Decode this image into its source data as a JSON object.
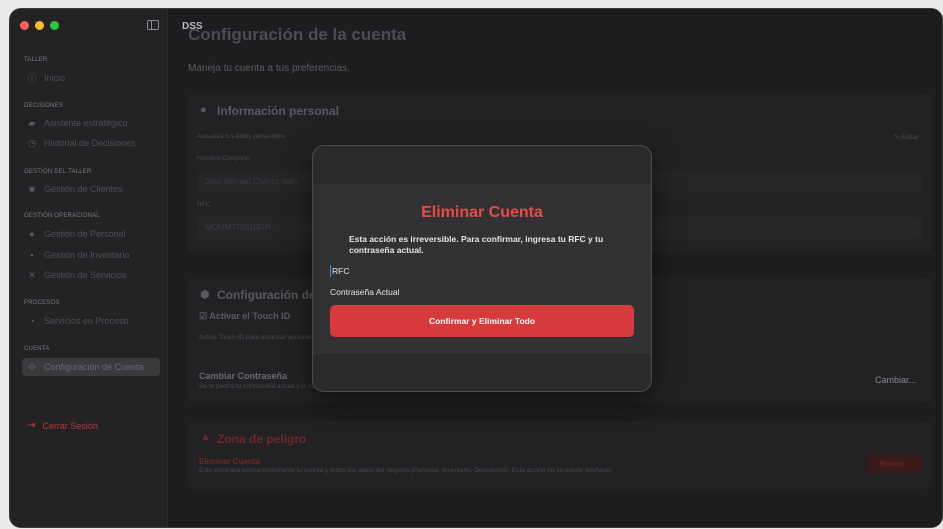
{
  "colors": {
    "accent_red": "#d73a3a",
    "modal_title_red": "#ec4a48",
    "traffic_red": "#ff5f57",
    "traffic_yellow": "#febc2e",
    "traffic_green": "#28c840"
  },
  "app": {
    "name": "DSS"
  },
  "sidebar": {
    "sections": [
      {
        "label": "TALLER",
        "items": [
          {
            "label": "Inicio",
            "icon": "info-icon"
          }
        ]
      },
      {
        "label": "DECISIONES",
        "items": [
          {
            "label": "Asistente estratégico",
            "icon": "chat-icon"
          },
          {
            "label": "Historial de Decisiones",
            "icon": "history-icon"
          }
        ]
      },
      {
        "label": "GESTIÓN DEL TALLER",
        "items": [
          {
            "label": "Gestión de Clientes",
            "icon": "clients-icon"
          }
        ]
      },
      {
        "label": "GESTIÓN OPERACIONAL",
        "items": [
          {
            "label": "Gestión de Personal",
            "icon": "people-icon"
          },
          {
            "label": "Gestión de Inventario",
            "icon": "box-icon"
          },
          {
            "label": "Gestión de Servicios",
            "icon": "tools-icon"
          }
        ]
      },
      {
        "label": "PROCESOS",
        "items": [
          {
            "label": "Servicios en Proceso",
            "icon": "timer-icon"
          }
        ]
      },
      {
        "label": "CUENTA",
        "items": [
          {
            "label": "Configuración de Cuenta",
            "icon": "gear-icon",
            "active": true
          }
        ]
      }
    ],
    "logout_label": "Cerrar Sesión"
  },
  "page": {
    "title": "Configuración de la cuenta",
    "subtitle": "Maneja tu cuenta a tus preferencias."
  },
  "personal_card": {
    "title": "Información personal",
    "subtitle": "Actualiza tus datos personales",
    "edit_label": "Editar",
    "name_label": "Nombre Completo",
    "name_value": "José Manuel Chávez Iván",
    "rfc_label": "RFC",
    "rfc_value": "MOMM770810FIR"
  },
  "security_card": {
    "title": "Configuración de Seguridad",
    "touchid_label": "Activar el Touch ID",
    "touchid_desc": "Activa Touch ID para autorizar acciones sensibles y recuperarla.",
    "password_title": "Cambiar Contraseña",
    "password_desc": "Se te pedirá tu contraseña actual y la nueva.",
    "change_label": "Cambiar..."
  },
  "danger_card": {
    "title": "Zona de peligro",
    "delete_title": "Eliminar Cuenta",
    "delete_desc": "Esto eliminará permanentemente tu cuenta y todos los datos del negocio (Personal, Inventario, Decisiones). Esta acción no se puede deshacer.",
    "delete_button": "Eliminar..."
  },
  "modal": {
    "title": "Eliminar Cuenta",
    "message": "Esta acción es irreversible. Para confirmar, ingresa tu RFC y tu contraseña actual.",
    "rfc_placeholder": "RFC",
    "password_placeholder": "Contraseña Actual",
    "confirm_label": "Confirmar y Eliminar Todo"
  }
}
